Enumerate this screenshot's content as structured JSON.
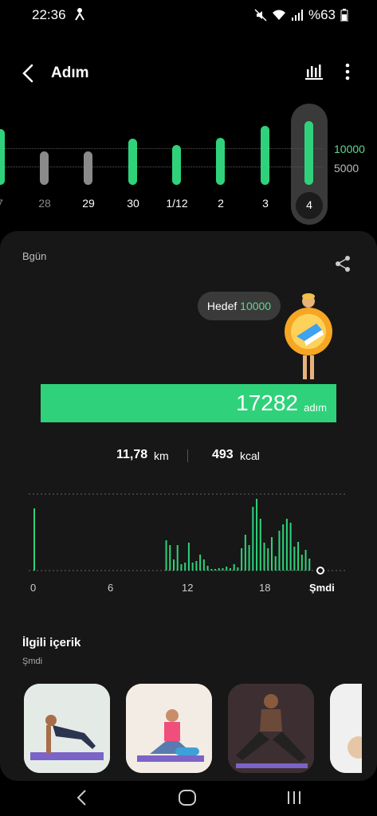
{
  "status_bar": {
    "time": "22:36",
    "battery": "%63"
  },
  "header": {
    "title": "Adım"
  },
  "week": {
    "days": [
      "7",
      "28",
      "29",
      "30",
      "1/12",
      "2",
      "3",
      "4"
    ],
    "levels": [
      "10000",
      "5000"
    ]
  },
  "card": {
    "period": "Bgün",
    "goal_label": "Hedef",
    "goal_value": "10000",
    "steps": "17282",
    "steps_unit": "adım",
    "distance": "11,78",
    "distance_unit": "km",
    "calories": "493",
    "calories_unit": "kcal",
    "axis": [
      "0",
      "6",
      "12",
      "18",
      "Şmdi"
    ]
  },
  "related": {
    "title": "İlgili içerik",
    "subtitle": "Şmdi"
  },
  "colors": {
    "accent": "#2fd27a",
    "inactive": "#8a8a8a"
  }
}
